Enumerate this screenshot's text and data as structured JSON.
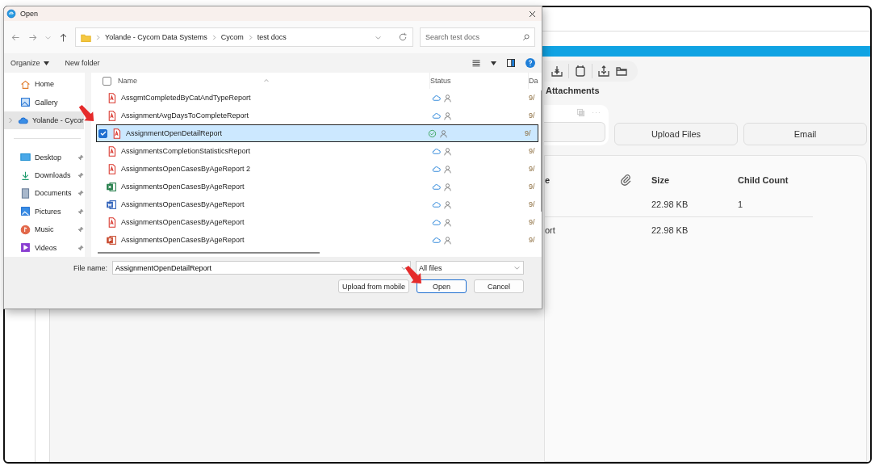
{
  "app": {
    "section_title": "Attachments",
    "buttons": [
      "Upload Files",
      "Email"
    ],
    "table": {
      "columns": [
        "e",
        "Size",
        "Child Count"
      ],
      "rows": [
        {
          "cells": [
            "",
            "22.98 KB",
            "1"
          ]
        },
        {
          "cells": [
            "ort",
            "22.98 KB",
            ""
          ]
        }
      ]
    }
  },
  "dialog": {
    "title": "Open",
    "breadcrumb": [
      "Yolande - Cycom Data Systems",
      "Cycom",
      "test docs"
    ],
    "search": {
      "placeholder": "Search test docs"
    },
    "commands": [
      "Organize",
      "New folder"
    ],
    "sidebar": [
      {
        "label": "Home",
        "kind": "home",
        "pinned": false,
        "selected": false
      },
      {
        "label": "Gallery",
        "kind": "gallery",
        "pinned": false,
        "selected": false
      },
      {
        "label": "Yolande - Cycor",
        "kind": "cloud",
        "pinned": false,
        "selected": true
      },
      {
        "label": "Desktop",
        "kind": "desktop",
        "pinned": true,
        "selected": false
      },
      {
        "label": "Downloads",
        "kind": "downloads",
        "pinned": true,
        "selected": false
      },
      {
        "label": "Documents",
        "kind": "documents",
        "pinned": true,
        "selected": false
      },
      {
        "label": "Pictures",
        "kind": "pictures",
        "pinned": true,
        "selected": false
      },
      {
        "label": "Music",
        "kind": "music",
        "pinned": true,
        "selected": false
      },
      {
        "label": "Videos",
        "kind": "videos",
        "pinned": true,
        "selected": false
      }
    ],
    "columns": [
      "Name",
      "Status",
      "Da"
    ],
    "select_all": {
      "checked": false
    },
    "files": [
      {
        "name": "AssgmtCompletedByCatAndTypeReport",
        "kind": "pdf",
        "status": {
          "kind": "cloud"
        },
        "date": "9/",
        "selected": false
      },
      {
        "name": "AssignmentAvgDaysToCompleteReport",
        "kind": "pdf",
        "status": {
          "kind": "cloud"
        },
        "date": "9/",
        "selected": false
      },
      {
        "name": "AssignmentOpenDetailReport",
        "kind": "pdf",
        "status": {
          "kind": "synced"
        },
        "date": "9/",
        "selected": true
      },
      {
        "name": "AssignmentsCompletionStatisticsReport",
        "kind": "pdf",
        "status": {
          "kind": "cloud"
        },
        "date": "9/",
        "selected": false
      },
      {
        "name": "AssignmentsOpenCasesByAgeReport 2",
        "kind": "pdf",
        "status": {
          "kind": "cloud"
        },
        "date": "9/",
        "selected": false
      },
      {
        "name": "AssignmentsOpenCasesByAgeReport",
        "kind": "excel",
        "status": {
          "kind": "cloud"
        },
        "date": "9/",
        "selected": false
      },
      {
        "name": "AssignmentsOpenCasesByAgeReport",
        "kind": "word",
        "status": {
          "kind": "cloud"
        },
        "date": "9/",
        "selected": false
      },
      {
        "name": "AssignmentsOpenCasesByAgeReport",
        "kind": "pdf",
        "status": {
          "kind": "cloud"
        },
        "date": "9/",
        "selected": false
      },
      {
        "name": "AssignmentsOpenCasesByAgeReport",
        "kind": "powerpoint",
        "status": {
          "kind": "cloud"
        },
        "date": "9/",
        "selected": false
      }
    ],
    "file_name": {
      "label": "File name:",
      "value": "AssignmentOpenDetailReport"
    },
    "file_type": "All files",
    "buttons": [
      {
        "label": "Upload from mobile",
        "primary": false
      },
      {
        "label": "Open",
        "primary": true
      },
      {
        "label": "Cancel",
        "primary": false
      }
    ]
  }
}
